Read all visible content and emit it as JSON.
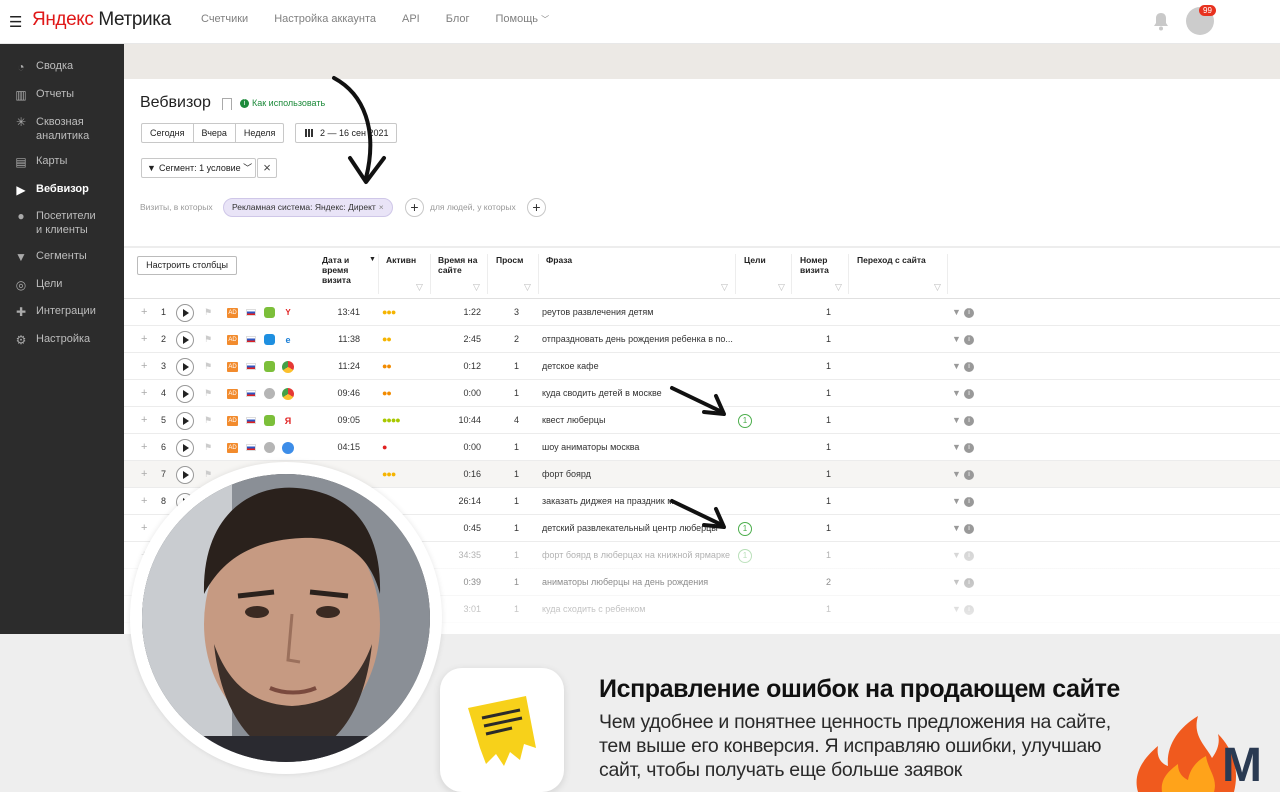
{
  "header": {
    "logo_prefix": "Яндекс",
    "logo_suffix": " Метрика",
    "nav": [
      "Счетчики",
      "Настройка аккаунта",
      "API",
      "Блог",
      "Помощь"
    ],
    "notifications_count": "99"
  },
  "sidebar": {
    "items": [
      {
        "label": "Сводка",
        "icon": "dashboard-icon"
      },
      {
        "label": "Отчеты",
        "icon": "bar-chart-icon"
      },
      {
        "label": "Сквозная аналитика",
        "icon": "end-to-end-icon"
      },
      {
        "label": "Карты",
        "icon": "map-icon"
      },
      {
        "label": "Вебвизор",
        "icon": "play-icon",
        "active": true
      },
      {
        "label": "Посетители и клиенты",
        "icon": "user-icon"
      },
      {
        "label": "Сегменты",
        "icon": "filter-icon"
      },
      {
        "label": "Цели",
        "icon": "target-icon"
      },
      {
        "label": "Интеграции",
        "icon": "puzzle-icon"
      },
      {
        "label": "Настройка",
        "icon": "gear-icon"
      }
    ]
  },
  "page": {
    "title": "Вебвизор",
    "howto": "Как использовать",
    "periods": [
      "Сегодня",
      "Вчера",
      "Неделя"
    ],
    "date_range": "2 — 16 сен 2021",
    "segment": "Сегмент: 1 условие",
    "visits_label": "Визиты, в которых",
    "condition_chip": "Рекламная система: Яндекс: Директ",
    "people_label": "для людей, у которых",
    "configure_columns": "Настроить столбцы"
  },
  "table": {
    "headers": {
      "datetime": "Дата и время визита",
      "activity": "Активн",
      "duration": "Время на сайте",
      "views": "Просм",
      "phrase": "Фраза",
      "goals": "Цели",
      "visit_number": "Номер визита",
      "referrer": "Переход с сайта"
    },
    "rows": [
      {
        "n": "1",
        "time": "13:41",
        "activity": 3,
        "activity_color": "#f5b400",
        "duration": "1:22",
        "views": "3",
        "phrase": "реутов развлечения детям",
        "goal": "",
        "visit_no": "1",
        "os": "android",
        "browser": "yandex"
      },
      {
        "n": "2",
        "time": "11:38",
        "activity": 2,
        "activity_color": "#f5b400",
        "duration": "2:45",
        "views": "2",
        "phrase": "отпраздновать день рождения ребенка в по...",
        "goal": "",
        "visit_no": "1",
        "os": "windows",
        "browser": "edge"
      },
      {
        "n": "3",
        "time": "11:24",
        "activity": 2,
        "activity_color": "#f28b00",
        "duration": "0:12",
        "views": "1",
        "phrase": "детское кафе",
        "goal": "",
        "visit_no": "1",
        "os": "android",
        "browser": "chrome"
      },
      {
        "n": "4",
        "time": "09:46",
        "activity": 2,
        "activity_color": "#f28b00",
        "duration": "0:00",
        "views": "1",
        "phrase": "куда сводить детей в москве",
        "goal": "",
        "visit_no": "1",
        "os": "apple",
        "browser": "chrome"
      },
      {
        "n": "5",
        "time": "09:05",
        "activity": 4,
        "activity_color": "#a8c800",
        "duration": "10:44",
        "views": "4",
        "phrase": "квест люберцы",
        "goal": "1",
        "visit_no": "1",
        "os": "android",
        "browser": "yandex-b"
      },
      {
        "n": "6",
        "time": "04:15",
        "activity": 1,
        "activity_color": "#e02020",
        "duration": "0:00",
        "views": "1",
        "phrase": "шоу аниматоры москва",
        "goal": "",
        "visit_no": "1",
        "os": "apple",
        "browser": "safari"
      },
      {
        "n": "7",
        "time": "",
        "activity": 3,
        "activity_color": "#f5b400",
        "duration": "0:16",
        "views": "1",
        "phrase": "форт боярд",
        "goal": "",
        "visit_no": "1",
        "os": "",
        "browser": "",
        "highlight": true
      },
      {
        "n": "8",
        "time": "",
        "activity": 0,
        "activity_color": "#f5b400",
        "duration": "26:14",
        "views": "1",
        "phrase": "заказать диджея на праздник м...",
        "goal": "",
        "visit_no": "1",
        "os": "",
        "browser": ""
      },
      {
        "n": "",
        "time": "",
        "activity": 0,
        "activity_color": "#f5b400",
        "duration": "0:45",
        "views": "1",
        "phrase": "детский развлекательный центр люберцы",
        "goal": "1",
        "visit_no": "1",
        "os": "",
        "browser": ""
      },
      {
        "n": "",
        "time": "",
        "activity": 0,
        "activity_color": "#f5b400",
        "duration": "34:35",
        "views": "1",
        "phrase": "форт боярд в люберцах на книжной ярмарке",
        "goal": "1",
        "visit_no": "1",
        "os": "",
        "browser": "",
        "faded": true
      },
      {
        "n": "",
        "time": "",
        "activity": 0,
        "activity_color": "#f5b400",
        "duration": "0:39",
        "views": "1",
        "phrase": "аниматоры люберцы на день рождения",
        "goal": "",
        "visit_no": "2",
        "os": "",
        "browser": ""
      },
      {
        "n": "",
        "time": "",
        "activity": 0,
        "activity_color": "#f5b400",
        "duration": "3:01",
        "views": "1",
        "phrase": "куда сходить с ребенком",
        "goal": "",
        "visit_no": "1",
        "os": "",
        "browser": ""
      }
    ]
  },
  "promo": {
    "title": "Исправление ошибок на продающем сайте",
    "text": "Чем удобнее и понятнее ценность предложения на сайте, тем выше его конверсия. Я исправляю ошибки, улучшаю сайт, чтобы получать еще больше заявок",
    "logo_letter": "M"
  },
  "colors": {
    "sidebar_bg": "#2c2c2c",
    "accent_green": "#1c8a3a",
    "ad_orange": "#f28b2d",
    "goal_green": "#4cae4c",
    "chip_bg": "#e9e4f7"
  }
}
